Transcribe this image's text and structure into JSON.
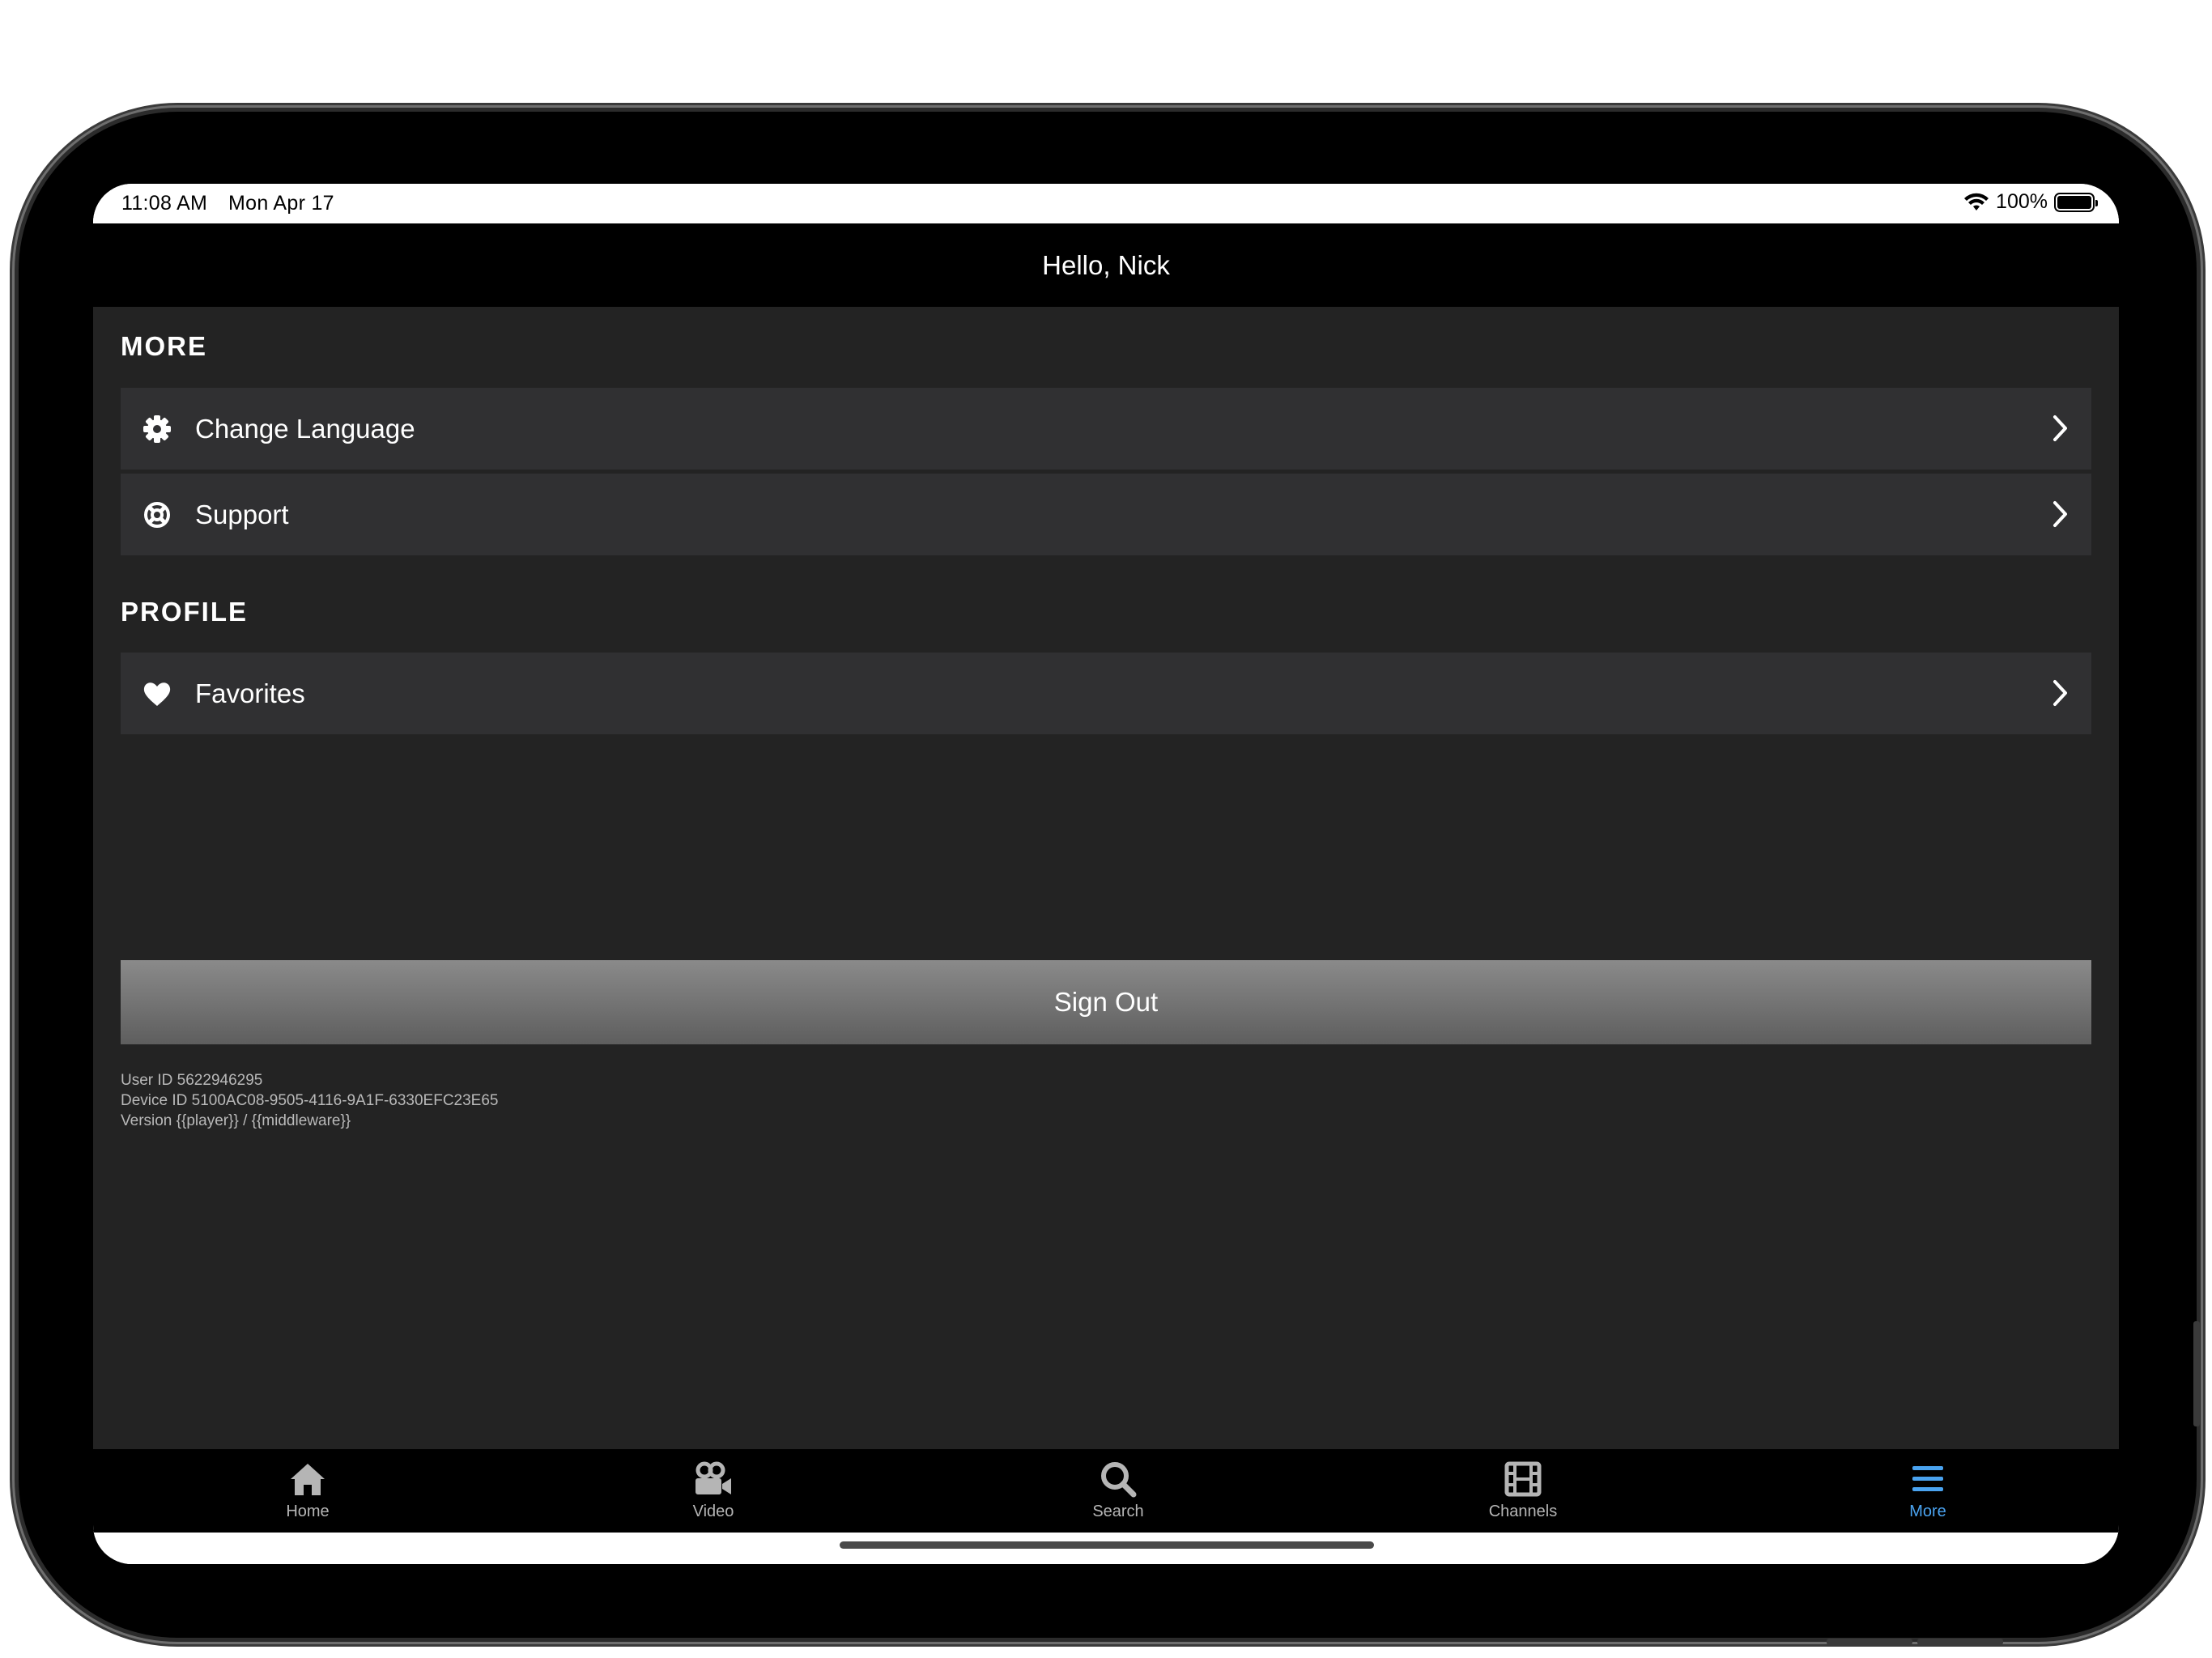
{
  "status_bar": {
    "time": "11:08 AM",
    "date": "Mon Apr 17",
    "battery": "100%"
  },
  "header": {
    "title": "Hello, Nick"
  },
  "sections": {
    "more": {
      "title": "MORE",
      "items": [
        {
          "label": "Change Language",
          "icon": "gear-icon"
        },
        {
          "label": "Support",
          "icon": "lifebuoy-icon"
        }
      ]
    },
    "profile": {
      "title": "PROFILE",
      "items": [
        {
          "label": "Favorites",
          "icon": "heart-icon"
        }
      ]
    }
  },
  "sign_out": {
    "label": "Sign Out"
  },
  "meta": {
    "user_id": "User ID 5622946295",
    "device_id": "Device ID 5100AC08-9505-4116-9A1F-6330EFC23E65",
    "version": "Version {{player}} / {{middleware}}"
  },
  "tabs": [
    {
      "label": "Home",
      "icon": "home-icon"
    },
    {
      "label": "Video",
      "icon": "video-camera-icon"
    },
    {
      "label": "Search",
      "icon": "search-icon"
    },
    {
      "label": "Channels",
      "icon": "film-icon"
    },
    {
      "label": "More",
      "icon": "menu-icon",
      "active": true
    }
  ],
  "colors": {
    "background": "#232323",
    "row": "#303032",
    "accent": "#4aa3f0"
  }
}
